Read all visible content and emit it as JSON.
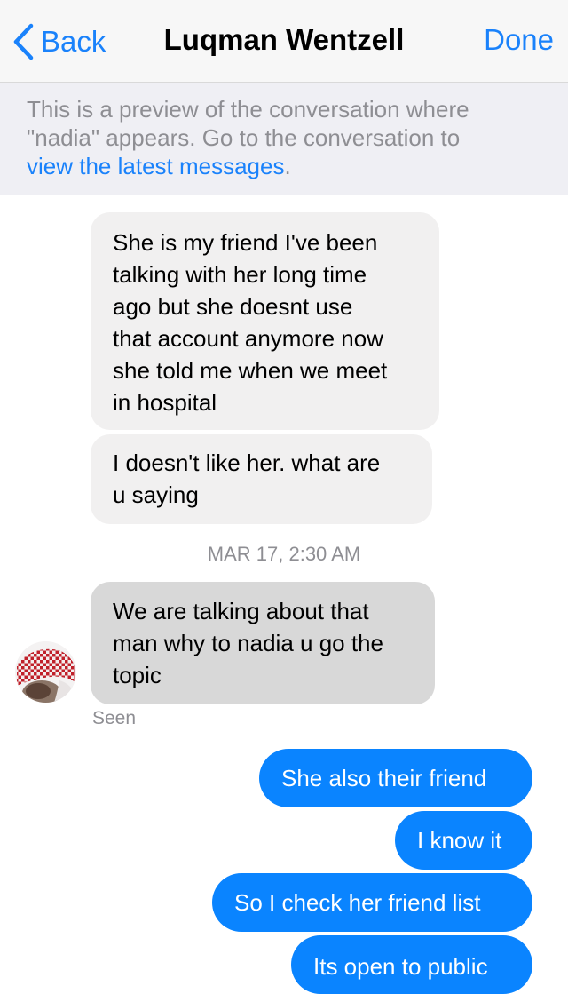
{
  "navbar": {
    "back_label": "Back",
    "title": "Luqman Wentzell",
    "done_label": "Done"
  },
  "preview_banner": {
    "line1": "This is a preview of the conversation where",
    "line2": "\"nadia\" appears. Go to the conversation to",
    "link_text": "view the latest messages",
    "suffix": "."
  },
  "messages": [
    {
      "direction": "incoming",
      "lines": [
        "She is my friend I've been",
        "talking with her long time",
        "ago but she doesnt use",
        "that account anymore now",
        "she told me when we meet",
        "in hospital"
      ]
    },
    {
      "direction": "incoming",
      "lines": [
        "I doesn't like her. what are",
        "u saying"
      ]
    },
    {
      "direction": "incoming",
      "highlighted": true,
      "lines": [
        "We are talking about that",
        "man why to nadia u go the",
        "topic"
      ]
    },
    {
      "direction": "outgoing",
      "text": "She also their friend"
    },
    {
      "direction": "outgoing",
      "text": "I know it"
    },
    {
      "direction": "outgoing",
      "text": "So I check her friend list"
    },
    {
      "direction": "outgoing",
      "text": "Its open to public"
    }
  ],
  "timestamp": "MAR 17, 2:30 AM",
  "seen_label": "Seen",
  "colors": {
    "accent": "#1a82fb",
    "outgoing_bubble": "#0a84ff",
    "incoming_bubble": "#f1f0f0",
    "highlighted_bubble": "#d8d8d8",
    "banner_bg": "#efeff4"
  },
  "icons": {
    "back": "chevron-left-icon",
    "avatar": "avatar"
  }
}
